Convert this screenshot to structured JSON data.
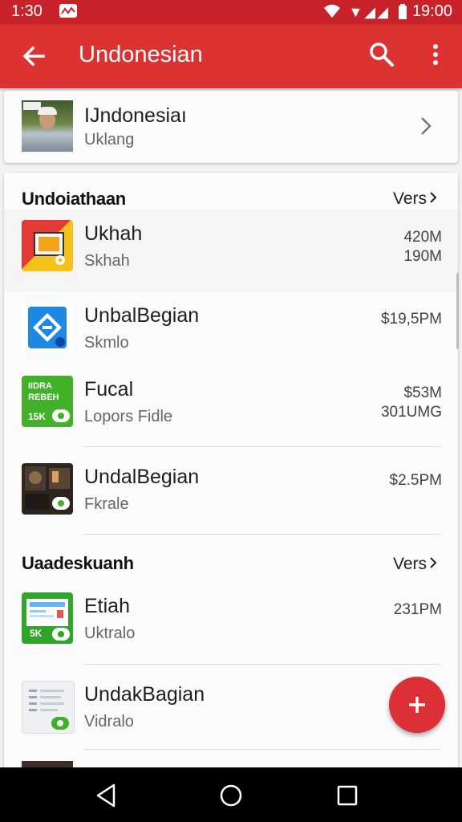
{
  "status": {
    "left_time": "1:30",
    "right_time": "19:00",
    "signal_text": "▼◢◢"
  },
  "appbar": {
    "title": "Undonesian"
  },
  "profile": {
    "name": "IJndonesiaı",
    "subtitle": "Uklang"
  },
  "sections": [
    {
      "title": "Undoiathaan",
      "link": "Vers",
      "items": [
        {
          "title": "Ukhah",
          "subtitle": "Skhah",
          "price1": "420M",
          "price2": "190M",
          "icon": "photo-app-icon"
        },
        {
          "title": "UnbalBegian",
          "subtitle": "Skmlo",
          "price1": "$19,5PM",
          "price2": "",
          "icon": "blue-shield-icon"
        },
        {
          "title": "Fucal",
          "subtitle": "Lopors Fidle",
          "price1": "$53M",
          "price2": "301UMG",
          "icon": "green-stream-icon",
          "icon_text": "IIDRA REBEH",
          "icon_num": "15K"
        },
        {
          "title": "UndalBegian",
          "subtitle": "Fkrale",
          "price1": "$2.5PM",
          "price2": "",
          "icon": "dark-photo-icon"
        }
      ]
    },
    {
      "title": "Uaadeskuanh",
      "link": "Vers",
      "items": [
        {
          "title": "Etiah",
          "subtitle": "Uktralo",
          "price1": "231PM",
          "price2": "",
          "icon": "green-monitor-icon",
          "icon_num": "5K"
        },
        {
          "title": "UndakBagian",
          "subtitle": "Vidralo",
          "price1": "",
          "price2": "",
          "icon": "doc-list-icon"
        }
      ]
    }
  ],
  "colors": {
    "primary": "#dc3232",
    "statusbar": "#c8232a",
    "fab": "#dd2f36"
  }
}
